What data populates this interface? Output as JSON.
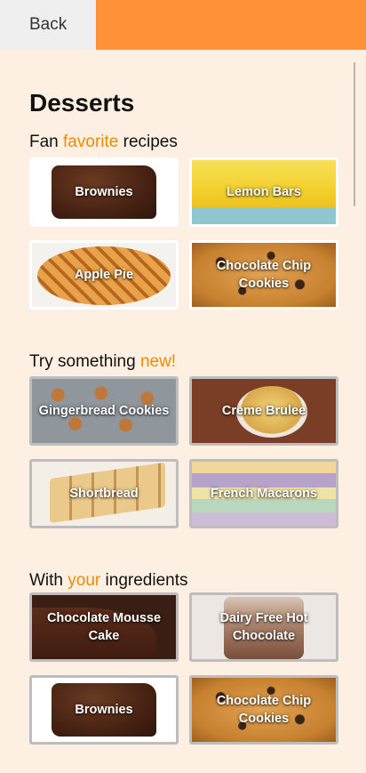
{
  "header": {
    "back_label": "Back",
    "accent_color": "#ff9138"
  },
  "page": {
    "title": "Desserts"
  },
  "sections": [
    {
      "pre": "Fan ",
      "highlight": "favorite",
      "post": " recipes",
      "cards": [
        {
          "label": "Brownies"
        },
        {
          "label": "Lemon Bars"
        },
        {
          "label": "Apple Pie"
        },
        {
          "label": "Chocolate Chip Cookies"
        }
      ]
    },
    {
      "pre": "Try something ",
      "highlight": "new!",
      "post": "",
      "cards": [
        {
          "label": "Gingerbread Cookies"
        },
        {
          "label": "Creme Brulee"
        },
        {
          "label": "Shortbread"
        },
        {
          "label": "French Macarons"
        }
      ]
    },
    {
      "pre": "With ",
      "highlight": "your",
      "post": " ingredients",
      "cards": [
        {
          "label": "Chocolate Mousse Cake"
        },
        {
          "label": "Dairy Free Hot Chocolate"
        },
        {
          "label": "Brownies"
        },
        {
          "label": "Chocolate Chip Cookies"
        }
      ]
    }
  ],
  "colors": {
    "background": "#fdf0e2",
    "highlight": "#f08a00"
  }
}
